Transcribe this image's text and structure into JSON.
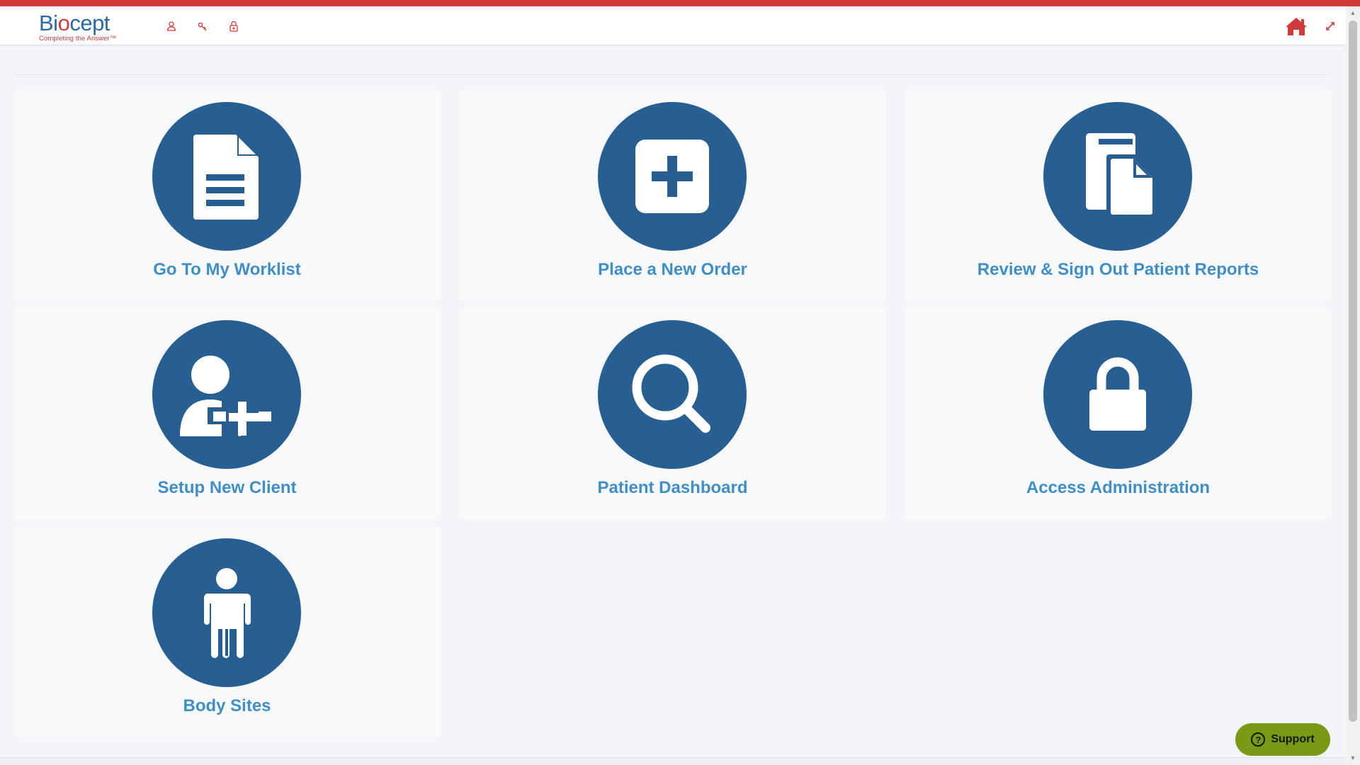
{
  "header": {
    "logo_text_pre": "Bi",
    "logo_text_o": "o",
    "logo_text_post": "cept",
    "logo_tagline": "Completing the Answer™",
    "icons": [
      "user-icon",
      "key-icon",
      "lock-icon"
    ],
    "home_icon": "home-icon",
    "expand_icon": "expand-icon"
  },
  "tiles": [
    {
      "label": "Go To My Worklist",
      "icon": "document-icon"
    },
    {
      "label": "Place a New Order",
      "icon": "plus-square-icon"
    },
    {
      "label": "Review & Sign Out Patient Reports",
      "icon": "copy-documents-icon"
    },
    {
      "label": "Setup New Client",
      "icon": "add-user-icon"
    },
    {
      "label": "Patient Dashboard",
      "icon": "search-icon"
    },
    {
      "label": "Access Administration",
      "icon": "lock-icon"
    },
    {
      "label": "Body Sites",
      "icon": "person-icon"
    }
  ],
  "support": {
    "label": "Support",
    "icon": "question-icon",
    "icon_glyph": "?"
  },
  "colors": {
    "accent_red": "#d03a3a",
    "tile_circle": "#275f92",
    "tile_label": "#3f8fc6",
    "support_bg": "#7a9a16"
  }
}
